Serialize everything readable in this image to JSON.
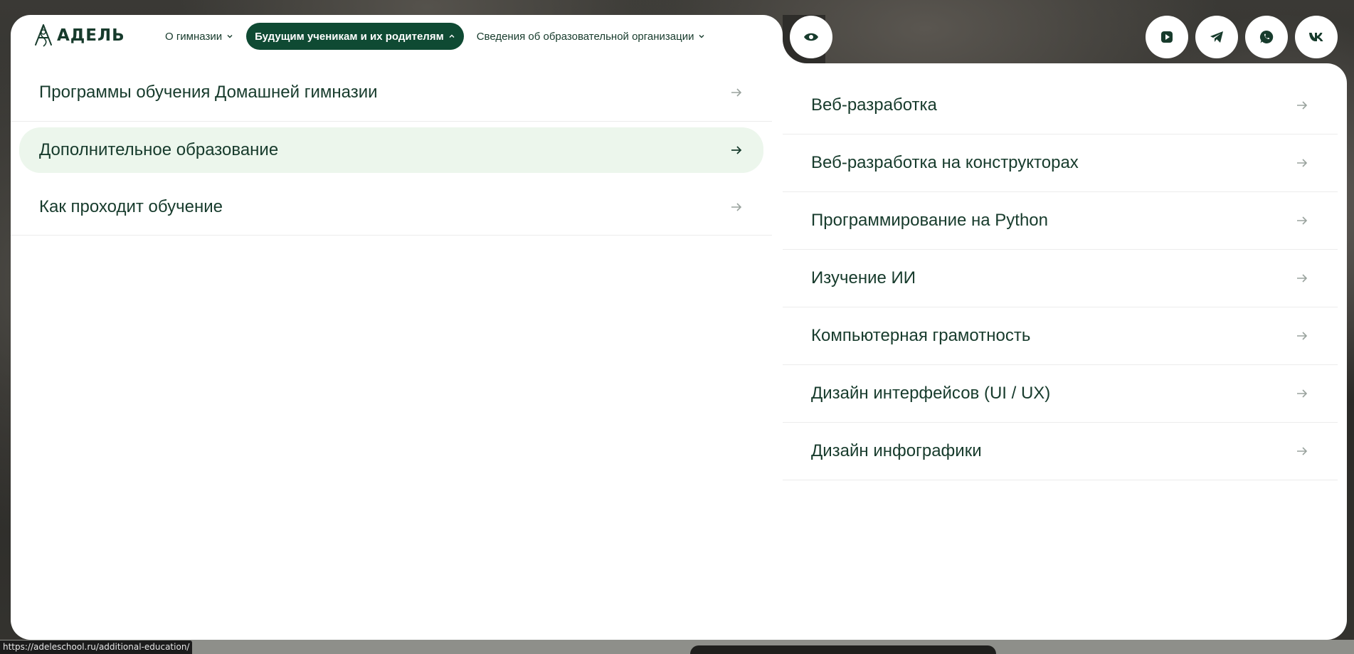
{
  "logo": {
    "text": "АДЕЛЬ"
  },
  "nav": [
    {
      "label": "О гимназии",
      "active": false
    },
    {
      "label": "Будущим ученикам и их родителям",
      "active": true
    },
    {
      "label": "Сведения об образовательной организации",
      "active": false
    }
  ],
  "icons": {
    "accessibility": "eye-icon",
    "social": [
      "rutube-icon",
      "telegram-icon",
      "whatsapp-icon",
      "vk-icon"
    ]
  },
  "left_menu": [
    {
      "label": "Программы обучения Домашней гимназии",
      "highlighted": false
    },
    {
      "label": "Дополнительное образование",
      "highlighted": true
    },
    {
      "label": "Как проходит обучение",
      "highlighted": false
    }
  ],
  "right_menu": [
    {
      "label": "Веб-разработка"
    },
    {
      "label": "Веб-разработка на конструкторах"
    },
    {
      "label": "Программирование на Python"
    },
    {
      "label": "Изучение ИИ"
    },
    {
      "label": "Компьютерная грамотность"
    },
    {
      "label": "Дизайн интерфейсов (UI / UX)"
    },
    {
      "label": "Дизайн инфографики"
    }
  ],
  "status_bar": {
    "url": "https://adeleschool.ru/additional-education/"
  },
  "colors": {
    "brand_dark_green": "#0f4a33",
    "text_green": "#173b2c",
    "highlight_bg": "#ecf6ec"
  }
}
